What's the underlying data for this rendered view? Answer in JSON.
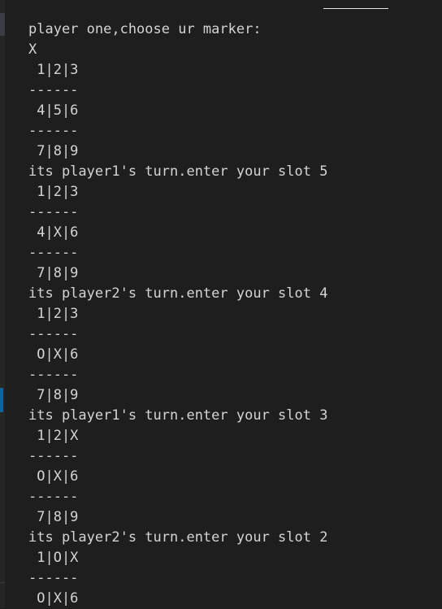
{
  "terminal": {
    "lines": [
      "player one,choose ur marker:",
      "X",
      " 1|2|3",
      "------",
      " 4|5|6",
      "------",
      " 7|8|9",
      "its player1's turn.enter your slot 5",
      " 1|2|3",
      "------",
      " 4|X|6",
      "------",
      " 7|8|9",
      "its player2's turn.enter your slot 4",
      " 1|2|3",
      "------",
      " O|X|6",
      "------",
      " 7|8|9",
      "its player1's turn.enter your slot 3",
      " 1|2|X",
      "------",
      " O|X|6",
      "------",
      " 7|8|9",
      "its player2's turn.enter your slot 2",
      " 1|O|X",
      "------",
      " O|X|6"
    ]
  }
}
